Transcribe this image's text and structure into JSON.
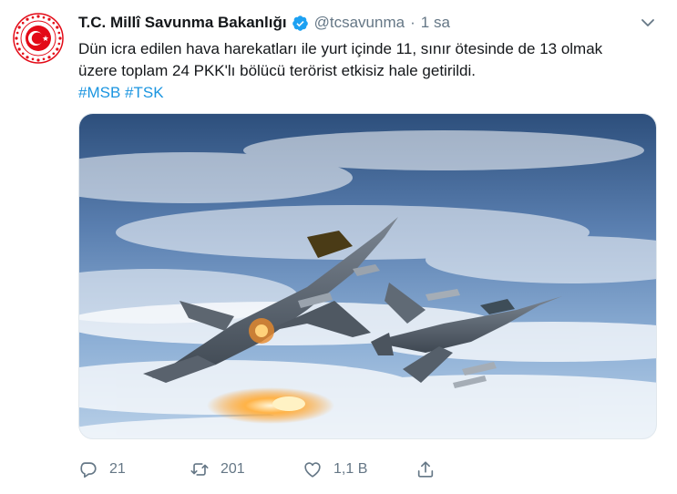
{
  "tweet": {
    "display_name": "T.C. Millî Savunma Bakanlığı",
    "handle": "@tcsavunma",
    "separator": "·",
    "time": "1 sa",
    "text_lines": [
      "Dün icra edilen hava harekatları ile yurt içinde 11, sınır ötesinde de 13 olmak",
      "üzere toplam 24 PKK'lı bölücü terörist etkisiz hale getirildi."
    ],
    "hashtags": [
      "#MSB",
      "#TSK"
    ],
    "media_description_icon": "fighter-jets-photo",
    "actions": {
      "reply_count": "21",
      "retweet_count": "201",
      "like_count": "1,1 B"
    }
  },
  "colors": {
    "accent": "#1b95e0",
    "verified": "#1da1f2",
    "muted": "#657786",
    "text": "#14171a",
    "emblem_red": "#e30a17"
  }
}
